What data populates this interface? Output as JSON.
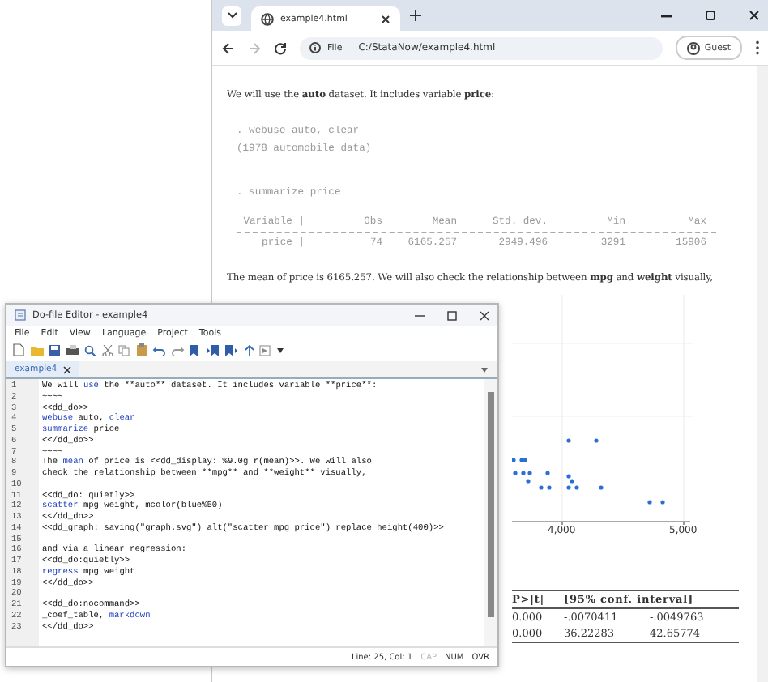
{
  "browser": {
    "tab_title": "example4.html",
    "url_scheme": "File",
    "url": "C:/StataNow/example4.html",
    "profile": "Guest"
  },
  "page": {
    "intro": "We will use the **auto** dataset. It includes variable **price**:",
    "code_1": [
      ". webuse auto, clear",
      "(1978 automobile data)"
    ],
    "code_2": [
      ". summarize price"
    ],
    "summary_header": [
      "Variable |",
      "Obs",
      "Mean",
      "Std. dev.",
      "Min",
      "Max"
    ],
    "summary_row": [
      "price |",
      "74",
      "6165.257",
      "2949.496",
      "3291",
      "15906"
    ],
    "mean_text": "The mean of price is 6165.257. We will also check the relationship between **mpg** and **weight** visually,",
    "scatter": {
      "x_tick_labels": [
        "4,000",
        "5,000"
      ]
    },
    "coef_table": {
      "headers": [
        "P>|t|",
        "[95% conf. interval]"
      ],
      "rows": [
        [
          "0.000",
          "-.0070411",
          "-.0049763"
        ],
        [
          "0.000",
          "36.22283",
          "42.65774"
        ]
      ]
    }
  },
  "editor": {
    "title": "Do-file Editor - example4",
    "menu": [
      "File",
      "Edit",
      "View",
      "Language",
      "Project",
      "Tools"
    ],
    "tab": "example4",
    "lines": [
      {
        "n": "1",
        "segments": [
          {
            "text": "We will ",
            "kind": "plain"
          },
          {
            "text": "use",
            "kind": "keyword"
          },
          {
            "text": " the **auto** dataset. It includes variable **price**:",
            "kind": "plain"
          }
        ]
      },
      {
        "n": "2",
        "segments": [
          {
            "text": "~~~~",
            "kind": "plain"
          }
        ]
      },
      {
        "n": "3",
        "segments": [
          {
            "text": "<<dd_do>>",
            "kind": "plain"
          }
        ]
      },
      {
        "n": "4",
        "segments": [
          {
            "text": "webuse",
            "kind": "keyword"
          },
          {
            "text": " auto, ",
            "kind": "plain"
          },
          {
            "text": "clear",
            "kind": "keyword"
          }
        ]
      },
      {
        "n": "5",
        "segments": [
          {
            "text": "summarize",
            "kind": "keyword"
          },
          {
            "text": " price",
            "kind": "plain"
          }
        ]
      },
      {
        "n": "6",
        "segments": [
          {
            "text": "<</dd_do>>",
            "kind": "plain"
          }
        ]
      },
      {
        "n": "7",
        "segments": [
          {
            "text": "~~~~",
            "kind": "plain"
          }
        ]
      },
      {
        "n": "8",
        "segments": [
          {
            "text": "The ",
            "kind": "plain"
          },
          {
            "text": "mean",
            "kind": "keyword"
          },
          {
            "text": " of price is <<dd_display: %9.0g r(mean)>>. We will also",
            "kind": "plain"
          }
        ]
      },
      {
        "n": "9",
        "segments": [
          {
            "text": "check the relationship between **mpg** and **weight** visually,",
            "kind": "plain"
          }
        ]
      },
      {
        "n": "10"
      },
      {
        "n": "11",
        "segments": [
          {
            "text": "<<dd_do: quietly>>",
            "kind": "plain"
          }
        ]
      },
      {
        "n": "12",
        "segments": [
          {
            "text": "scatter",
            "kind": "keyword"
          },
          {
            "text": " mpg weight, mcolor(blue%50)",
            "kind": "plain"
          }
        ]
      },
      {
        "n": "13",
        "segments": [
          {
            "text": "<</dd_do>>",
            "kind": "plain"
          }
        ]
      },
      {
        "n": "14",
        "segments": [
          {
            "text": "<<dd_graph: saving(\"graph.svg\") alt(\"scatter mpg price\") replace height(400)>>",
            "kind": "plain"
          }
        ]
      },
      {
        "n": "15"
      },
      {
        "n": "16",
        "segments": [
          {
            "text": "and via a linear regression:",
            "kind": "plain"
          }
        ]
      },
      {
        "n": "17",
        "segments": [
          {
            "text": "<<dd_do:quietly>>",
            "kind": "plain"
          }
        ]
      },
      {
        "n": "18",
        "segments": [
          {
            "text": "regress",
            "kind": "keyword"
          },
          {
            "text": " mpg weight",
            "kind": "plain"
          }
        ]
      },
      {
        "n": "19",
        "segments": [
          {
            "text": "<</dd_do>>",
            "kind": "plain"
          }
        ]
      },
      {
        "n": "20"
      },
      {
        "n": "21",
        "segments": [
          {
            "text": "<<dd_do:nocommand>>",
            "kind": "plain"
          }
        ]
      },
      {
        "n": "22",
        "segments": [
          {
            "text": "_coef_table, ",
            "kind": "plain"
          },
          {
            "text": "markdown",
            "kind": "keyword"
          }
        ]
      },
      {
        "n": "23",
        "segments": [
          {
            "text": "<</dd_do>>",
            "kind": "plain"
          }
        ]
      }
    ],
    "status": {
      "position": "Line: 25, Col: 1",
      "indicators": [
        {
          "label": "CAP",
          "on": false
        },
        {
          "label": "NUM",
          "on": true
        },
        {
          "label": "OVR",
          "on": true
        }
      ]
    }
  }
}
